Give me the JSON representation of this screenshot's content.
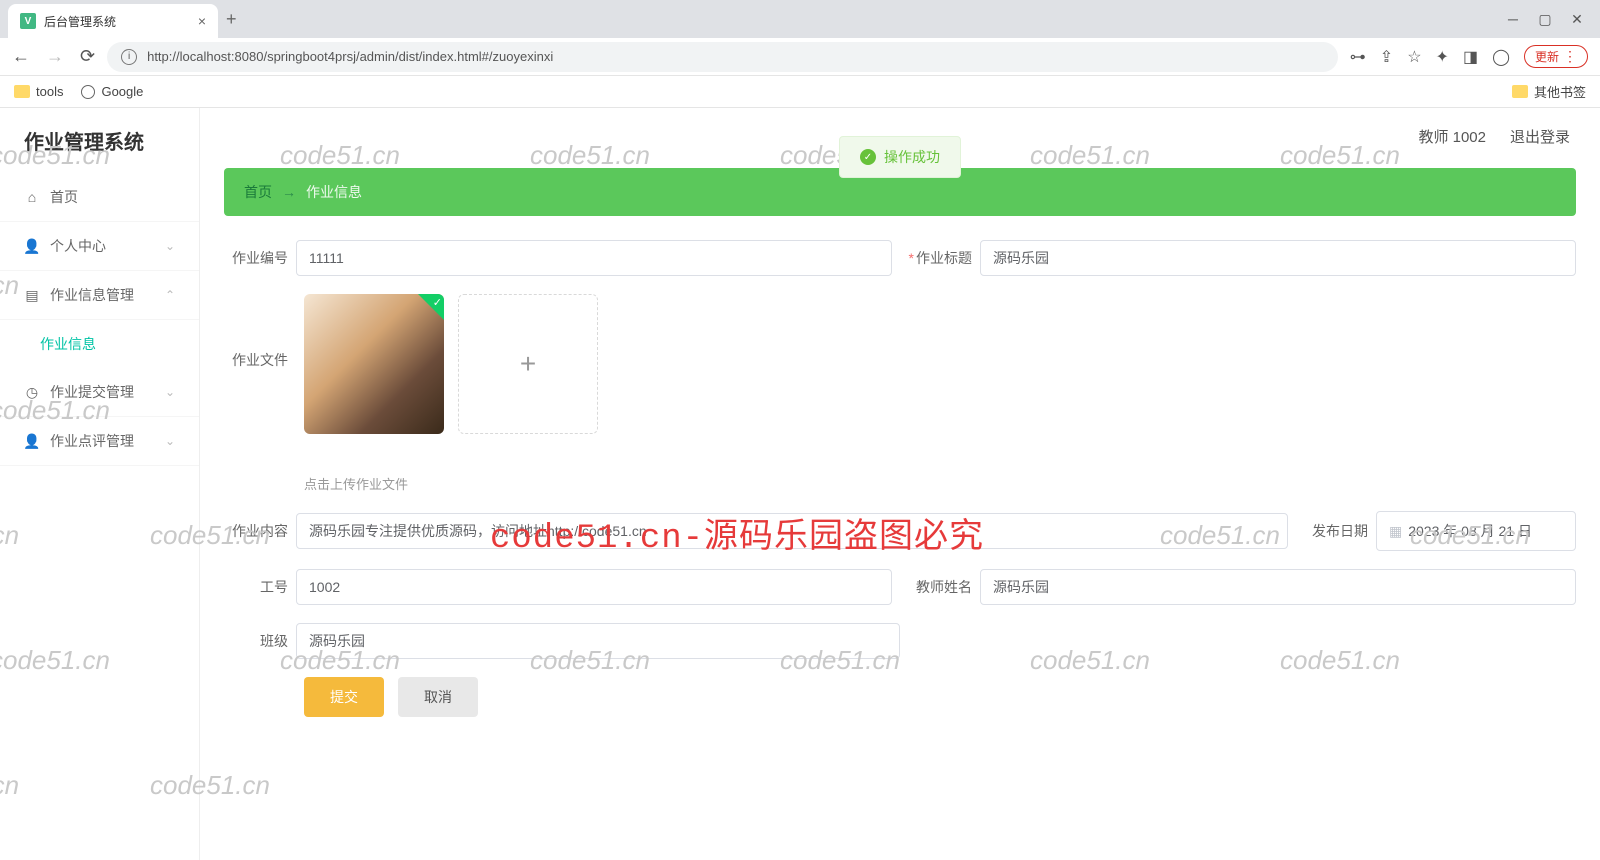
{
  "browser": {
    "tab_title": "后台管理系统",
    "url": "http://localhost:8080/springboot4prsj/admin/dist/index.html#/zuoyexinxi",
    "bookmarks": {
      "tools": "tools",
      "google": "Google",
      "other": "其他书签"
    },
    "update": "更新"
  },
  "app": {
    "title": "作业管理系统",
    "menu": {
      "home": "首页",
      "personal": "个人中心",
      "workinfo": "作业信息管理",
      "workinfo_sub": "作业信息",
      "submit": "作业提交管理",
      "review": "作业点评管理"
    },
    "topbar": {
      "user": "教师 1002",
      "logout": "退出登录"
    },
    "toast": "操作成功",
    "breadcrumb": {
      "home": "首页",
      "arrow": "→",
      "current": "作业信息"
    }
  },
  "form": {
    "labels": {
      "id": "作业编号",
      "title": "作业标题",
      "file": "作业文件",
      "content": "作业内容",
      "date": "发布日期",
      "empid": "工号",
      "teacher": "教师姓名",
      "class": "班级"
    },
    "values": {
      "id": "11111",
      "title": "源码乐园",
      "content": "源码乐园专注提供优质源码，访问地址http://code51.cn",
      "date": "2023 年 08 月 21 日",
      "empid": "1002",
      "teacher": "源码乐园",
      "class": "源码乐园"
    },
    "upload_tip": "点击上传作业文件",
    "buttons": {
      "submit": "提交",
      "cancel": "取消"
    }
  },
  "watermark": {
    "text": "code51.cn",
    "red": "code51.cn-源码乐园盗图必究"
  }
}
